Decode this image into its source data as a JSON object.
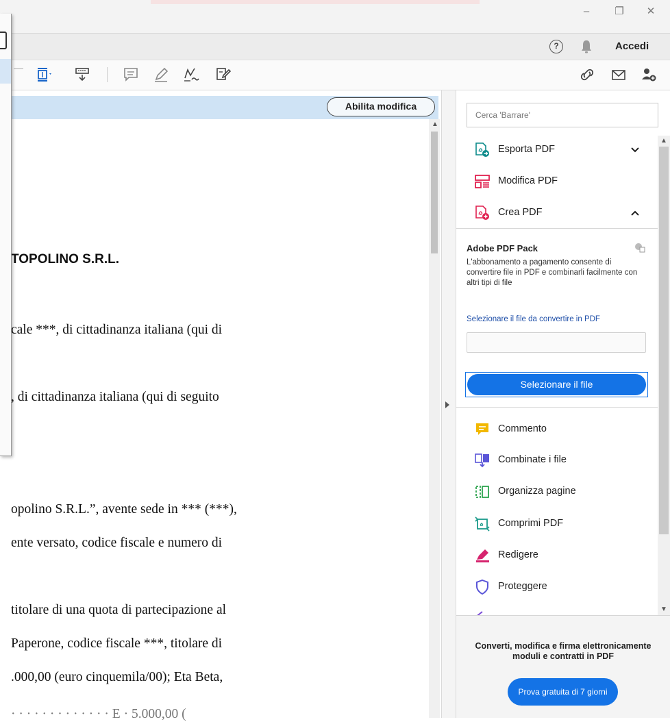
{
  "window": {
    "minimize": "–",
    "restore": "❐",
    "close": "✕"
  },
  "menu": {
    "help_glyph": "?",
    "sign_in": "Accedi"
  },
  "edit_banner": {
    "button_label": "Abilita modifica"
  },
  "document": {
    "title_fragment": "TOPOLINO S.R.L.",
    "lines": [
      "cale ***, di cittadinanza italiana (qui di",
      ", di cittadinanza italiana (qui di seguito",
      "opolino S.R.L.”, avente sede in *** (***),",
      "ente versato, codice fiscale e numero di",
      "titolare di una quota di partecipazione al",
      "Paperone, codice fiscale ***, titolare di",
      ".000,00 (euro cinquemila/00); Eta Beta,",
      "·  ·  ·  ·  ·  ·  ·  ·  ·  ·  ·  ·  ·  E ·   5.000,00 ("
    ]
  },
  "right_pane": {
    "search_placeholder": "Cerca 'Barrare'",
    "tools_top": [
      {
        "label": "Esporta PDF",
        "icon": "export-pdf-icon",
        "expanded": false
      },
      {
        "label": "Modifica PDF",
        "icon": "edit-pdf-icon"
      },
      {
        "label": "Crea PDF",
        "icon": "create-pdf-icon",
        "expanded": true
      }
    ],
    "pdf_pack": {
      "title": "Adobe PDF Pack",
      "description": "L'abbonamento a pagamento consente di convertire file in PDF e combinarli facilmente con altri tipi di file",
      "select_link": "Selezionare il file da convertire in PDF",
      "select_button": "Selezionare il file"
    },
    "tools_bottom": [
      {
        "label": "Commento",
        "icon": "comment-icon"
      },
      {
        "label": "Combinate i file",
        "icon": "combine-files-icon"
      },
      {
        "label": "Organizza pagine",
        "icon": "organize-pages-icon"
      },
      {
        "label": "Comprimi PDF",
        "icon": "compress-pdf-icon"
      },
      {
        "label": "Redigere",
        "icon": "redact-icon"
      },
      {
        "label": "Proteggere",
        "icon": "protect-icon"
      }
    ],
    "promo": {
      "text": "Converti, modifica e firma elettronicamente moduli e contratti in PDF",
      "button": "Prova gratuita di 7 giorni"
    }
  },
  "colors": {
    "accent": "#1473e6",
    "banner": "#cfe3f5",
    "export": "#0b8a8a",
    "edit": "#e0204f",
    "create": "#e0204f",
    "comment": "#f2b800",
    "combine": "#5a55d8",
    "organize": "#2ea44f",
    "compress": "#1a9a8a",
    "redact": "#d6246e",
    "protect": "#5a55d8"
  }
}
